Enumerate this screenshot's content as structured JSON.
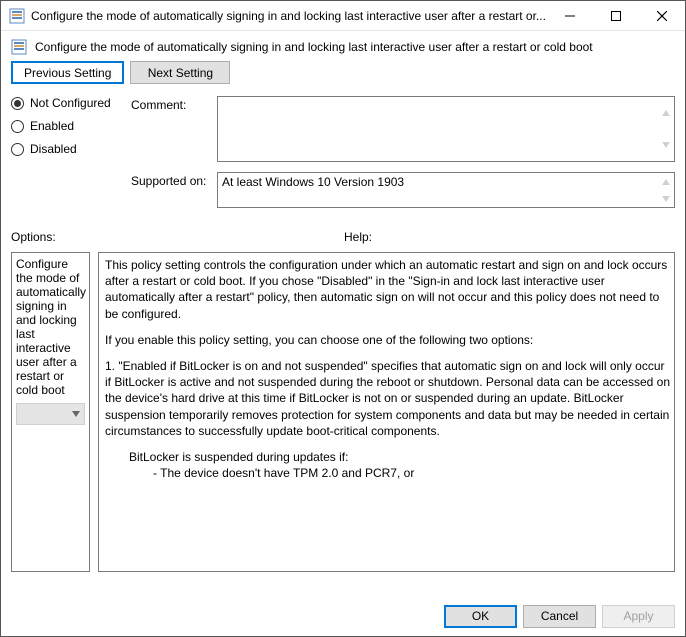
{
  "window": {
    "title": "Configure the mode of automatically signing in and locking last interactive user after a restart or..."
  },
  "header": {
    "text": "Configure the mode of automatically signing in and locking last interactive user after a restart or cold boot"
  },
  "nav": {
    "previous": "Previous Setting",
    "next": "Next Setting"
  },
  "state": {
    "not_configured": "Not Configured",
    "enabled": "Enabled",
    "disabled": "Disabled",
    "selected": "not_configured"
  },
  "fields": {
    "comment_label": "Comment:",
    "comment_value": "",
    "supported_label": "Supported on:",
    "supported_value": "At least Windows 10 Version 1903"
  },
  "sections": {
    "options_label": "Options:",
    "help_label": "Help:"
  },
  "options": {
    "description": "Configure the mode of automatically signing in and locking last interactive user after a restart or cold boot",
    "dropdown_value": ""
  },
  "help": {
    "p1": "This policy setting controls the configuration under which an automatic restart and sign on and lock occurs after a restart or cold boot. If you chose \"Disabled\" in the \"Sign-in and lock last interactive user automatically after a restart\" policy, then automatic sign on will not occur and this policy does not need to be configured.",
    "p2": "If you enable this policy setting, you can choose one of the following two options:",
    "p3": "1. \"Enabled if BitLocker is on and not suspended\" specifies that automatic sign on and lock will only occur if BitLocker is active and not suspended during the reboot or shutdown. Personal data can be accessed on the device's hard drive at this time if BitLocker is not on or suspended during an update. BitLocker suspension temporarily removes protection for system components and data but may be needed in certain circumstances to successfully update boot-critical components.",
    "p4": "BitLocker is suspended during updates if:",
    "p5": "- The device doesn't have TPM 2.0 and PCR7, or"
  },
  "footer": {
    "ok": "OK",
    "cancel": "Cancel",
    "apply": "Apply"
  }
}
